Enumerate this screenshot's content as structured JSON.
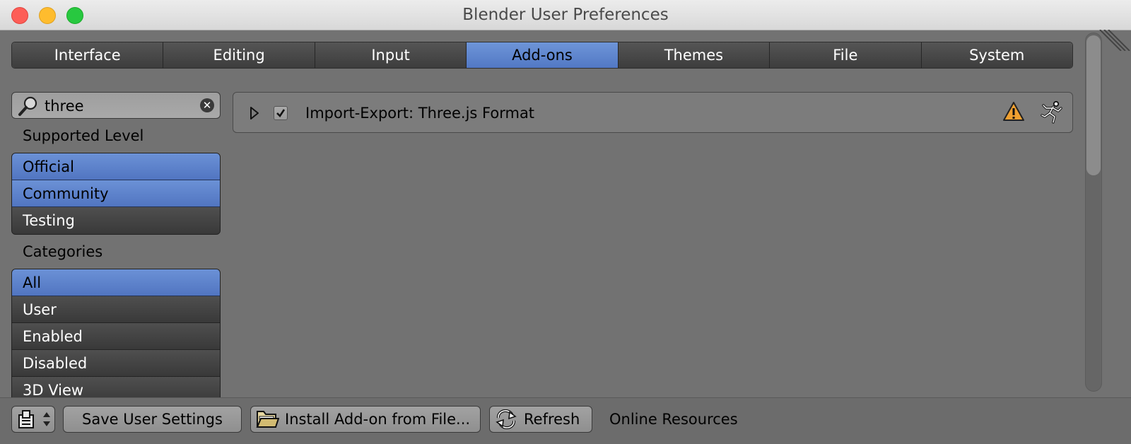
{
  "window": {
    "title": "Blender User Preferences"
  },
  "tabs": [
    {
      "label": "Interface",
      "active": false
    },
    {
      "label": "Editing",
      "active": false
    },
    {
      "label": "Input",
      "active": false
    },
    {
      "label": "Add-ons",
      "active": true
    },
    {
      "label": "Themes",
      "active": false
    },
    {
      "label": "File",
      "active": false
    },
    {
      "label": "System",
      "active": false
    }
  ],
  "search": {
    "value": "three",
    "icon": "magnifier-icon",
    "clear_icon": "clear-icon"
  },
  "supported_level": {
    "label": "Supported Level",
    "items": [
      {
        "label": "Official",
        "selected": true
      },
      {
        "label": "Community",
        "selected": true
      },
      {
        "label": "Testing",
        "selected": false
      }
    ]
  },
  "categories": {
    "label": "Categories",
    "items": [
      {
        "label": "All",
        "selected": true
      },
      {
        "label": "User",
        "selected": false
      },
      {
        "label": "Enabled",
        "selected": false
      },
      {
        "label": "Disabled",
        "selected": false
      },
      {
        "label": "3D View",
        "selected": false
      }
    ]
  },
  "addons": [
    {
      "name": "Import-Export: Three.js Format",
      "enabled": true,
      "expanded": false,
      "icons": [
        "warning-icon",
        "community-runner-icon"
      ]
    }
  ],
  "bottom": {
    "save_label": "Save User Settings",
    "install_label": "Install Add-on from File...",
    "refresh_label": "Refresh",
    "online_label": "Online Resources"
  },
  "colors": {
    "selected": "#5a80cb",
    "background": "#727272",
    "warning": "#f0a030"
  }
}
